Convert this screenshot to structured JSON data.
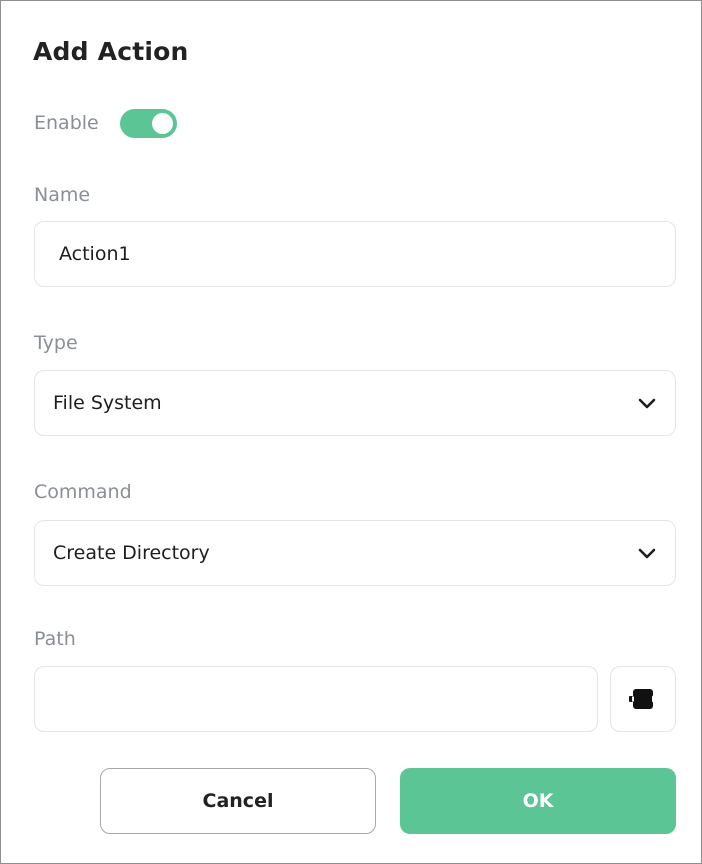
{
  "dialog": {
    "title": "Add Action"
  },
  "enable": {
    "label": "Enable",
    "on": true,
    "color": "#5bc595"
  },
  "name": {
    "label": "Name",
    "value": "Action1"
  },
  "type": {
    "label": "Type",
    "selected": "File System"
  },
  "command": {
    "label": "Command",
    "selected": "Create Directory"
  },
  "path": {
    "label": "Path",
    "value": "",
    "browse_icon": "plugin-icon"
  },
  "buttons": {
    "cancel_label": "Cancel",
    "ok_label": "OK"
  }
}
